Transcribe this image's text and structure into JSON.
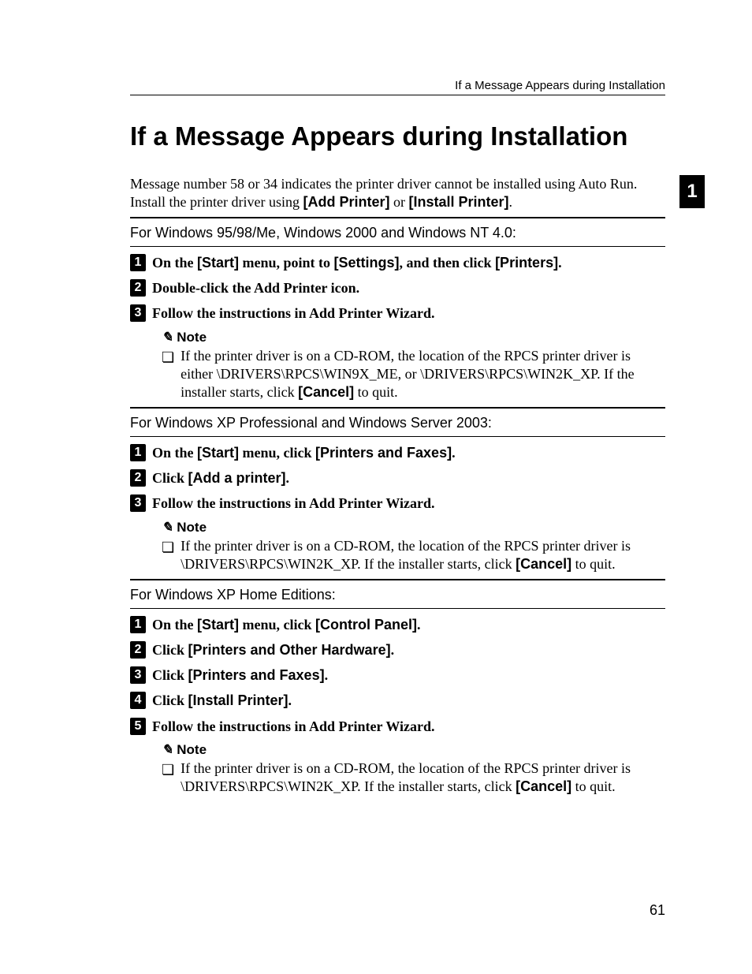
{
  "runningHead": "If a Message Appears during Installation",
  "title": "If a Message Appears during Installation",
  "intro_plain_1": "Message number 58 or 34 indicates the printer driver cannot be installed using Auto Run. Install the printer driver using ",
  "intro_bold_1": "[Add Printer]",
  "intro_plain_2": " or ",
  "intro_bold_2": "[Install Printer]",
  "intro_plain_3": ".",
  "sideTab": "1",
  "pageNumber": "61",
  "noteLabel": "Note",
  "pencil": "✎",
  "bulletGlyph": "❏",
  "sections": [
    {
      "label": "For Windows 95/98/Me, Windows 2000 and Windows NT 4.0:",
      "steps": [
        {
          "n": "1",
          "parts": [
            "On the ",
            "[Start]",
            " menu, point to ",
            "[Settings]",
            ", and then click ",
            "[Printers]",
            "."
          ]
        },
        {
          "n": "2",
          "parts": [
            "Double-click the Add Printer icon."
          ]
        },
        {
          "n": "3",
          "parts": [
            "Follow the instructions in Add Printer Wizard."
          ]
        }
      ],
      "note": {
        "parts": [
          "If the printer driver is on a CD-ROM, the location of the RPCS printer driver is either \\DRIVERS\\RPCS\\WIN9X_ME, or \\DRIVERS\\RPCS\\WIN2K_XP. If the installer starts, click ",
          "[Cancel]",
          " to quit."
        ]
      }
    },
    {
      "label": "For Windows XP Professional and Windows Server 2003:",
      "steps": [
        {
          "n": "1",
          "parts": [
            "On the ",
            "[Start]",
            " menu, click ",
            "[Printers and Faxes]",
            "."
          ]
        },
        {
          "n": "2",
          "parts": [
            "Click ",
            "[Add a printer]",
            "."
          ]
        },
        {
          "n": "3",
          "parts": [
            "Follow the instructions in Add Printer Wizard."
          ]
        }
      ],
      "note": {
        "parts": [
          "If the printer driver is on a CD-ROM, the location of the RPCS printer driver is \\DRIVERS\\RPCS\\WIN2K_XP. If the installer starts, click ",
          "[Cancel]",
          " to quit."
        ]
      }
    },
    {
      "label": "For Windows XP Home Editions:",
      "steps": [
        {
          "n": "1",
          "parts": [
            "On the ",
            "[Start]",
            " menu, click ",
            "[Control Panel]",
            "."
          ]
        },
        {
          "n": "2",
          "parts": [
            "Click ",
            "[Printers and Other Hardware]",
            "."
          ]
        },
        {
          "n": "3",
          "parts": [
            "Click ",
            "[Printers and Faxes]",
            "."
          ]
        },
        {
          "n": "4",
          "parts": [
            "Click ",
            "[Install Printer]",
            "."
          ]
        },
        {
          "n": "5",
          "parts": [
            "Follow the instructions in Add Printer Wizard."
          ]
        }
      ],
      "note": {
        "parts": [
          "If the printer driver is on a CD-ROM, the location of the RPCS printer driver is \\DRIVERS\\RPCS\\WIN2K_XP. If the installer starts, click ",
          "[Cancel]",
          " to quit."
        ]
      }
    }
  ]
}
